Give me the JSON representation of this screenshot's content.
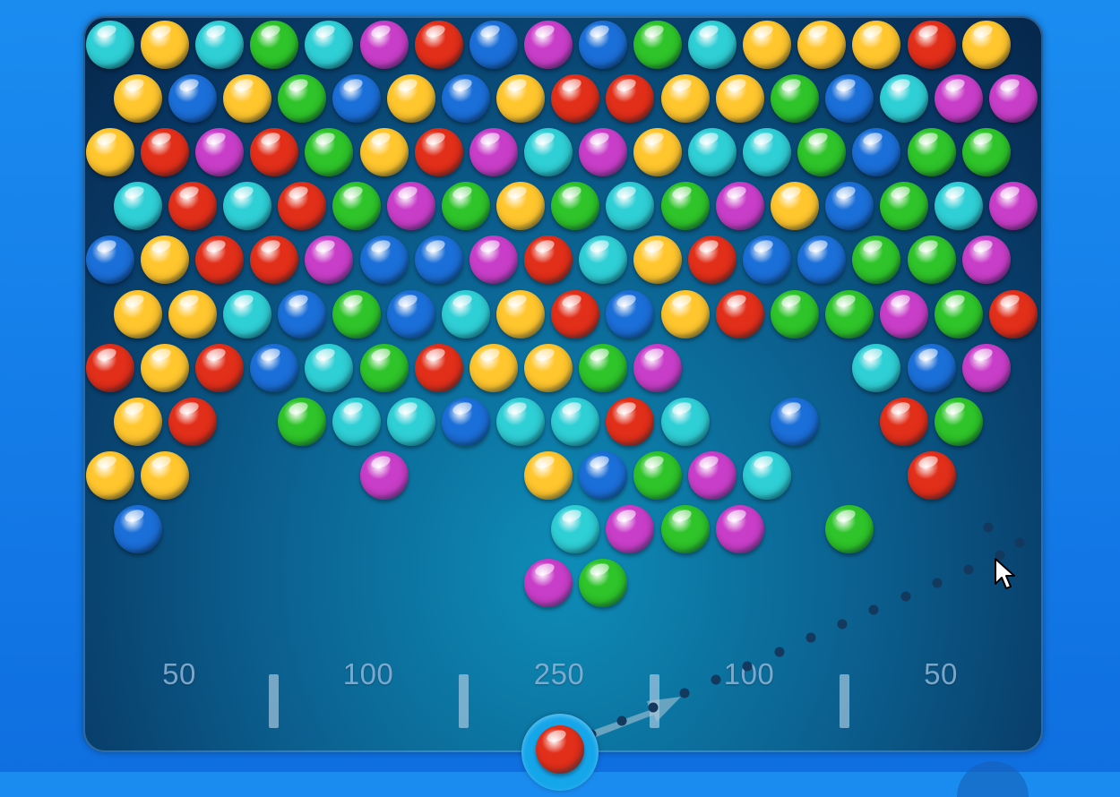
{
  "game": {
    "colors": {
      "teal": "#2fcfd6",
      "yellow": "#ffc62e",
      "green": "#2ec42a",
      "magenta": "#c93ec9",
      "red": "#e22f1a",
      "blue": "#1b6fd8"
    },
    "grid": [
      [
        "teal",
        "yellow",
        "teal",
        "green",
        "teal",
        "magenta",
        "red",
        "blue",
        "magenta",
        "blue",
        "green",
        "teal",
        "yellow",
        "yellow",
        "yellow",
        "red",
        "yellow"
      ],
      [
        "yellow",
        "blue",
        "yellow",
        "green",
        "blue",
        "yellow",
        "blue",
        "yellow",
        "red",
        "red",
        "yellow",
        "yellow",
        "green",
        "blue",
        "teal",
        "magenta",
        "magenta"
      ],
      [
        "yellow",
        "red",
        "magenta",
        "red",
        "green",
        "yellow",
        "red",
        "magenta",
        "teal",
        "magenta",
        "yellow",
        "teal",
        "teal",
        "green",
        "blue",
        "green",
        "green"
      ],
      [
        "teal",
        "red",
        "teal",
        "red",
        "green",
        "magenta",
        "green",
        "yellow",
        "green",
        "teal",
        "green",
        "magenta",
        "yellow",
        "blue",
        "green",
        "teal",
        "magenta"
      ],
      [
        "blue",
        "yellow",
        "red",
        "red",
        "magenta",
        "blue",
        "blue",
        "magenta",
        "red",
        "teal",
        "yellow",
        "red",
        "blue",
        "blue",
        "green",
        "green",
        "magenta"
      ],
      [
        "yellow",
        "yellow",
        "teal",
        "blue",
        "green",
        "blue",
        "teal",
        "yellow",
        "red",
        "blue",
        "yellow",
        "red",
        "green",
        "green",
        "magenta",
        "green",
        "red"
      ],
      [
        "red",
        "yellow",
        "red",
        "blue",
        "teal",
        "green",
        "red",
        "yellow",
        "yellow",
        "green",
        "magenta",
        null,
        null,
        null,
        "teal",
        "blue",
        "magenta"
      ],
      [
        "yellow",
        "red",
        null,
        "green",
        "teal",
        "teal",
        "blue",
        "teal",
        "teal",
        "red",
        "teal",
        null,
        "blue",
        null,
        "red",
        "green",
        null
      ],
      [
        "yellow",
        "yellow",
        null,
        null,
        null,
        "magenta",
        null,
        null,
        "yellow",
        "blue",
        "green",
        "magenta",
        "teal",
        null,
        null,
        "red",
        null
      ],
      [
        "blue",
        null,
        null,
        null,
        null,
        null,
        null,
        null,
        "teal",
        "magenta",
        "green",
        "magenta",
        null,
        "green",
        null,
        null,
        null
      ],
      [
        null,
        null,
        null,
        null,
        null,
        null,
        null,
        null,
        "magenta",
        "green",
        null,
        null,
        null,
        null,
        null,
        null,
        null
      ]
    ],
    "score_zones": [
      "50",
      "100",
      "250",
      "100",
      "50"
    ],
    "shooter": {
      "color": "red",
      "icon": "red-bubble"
    },
    "aim": {
      "icon": "aim-arrow"
    },
    "cursor": {
      "icon": "mouse-pointer-icon"
    }
  }
}
